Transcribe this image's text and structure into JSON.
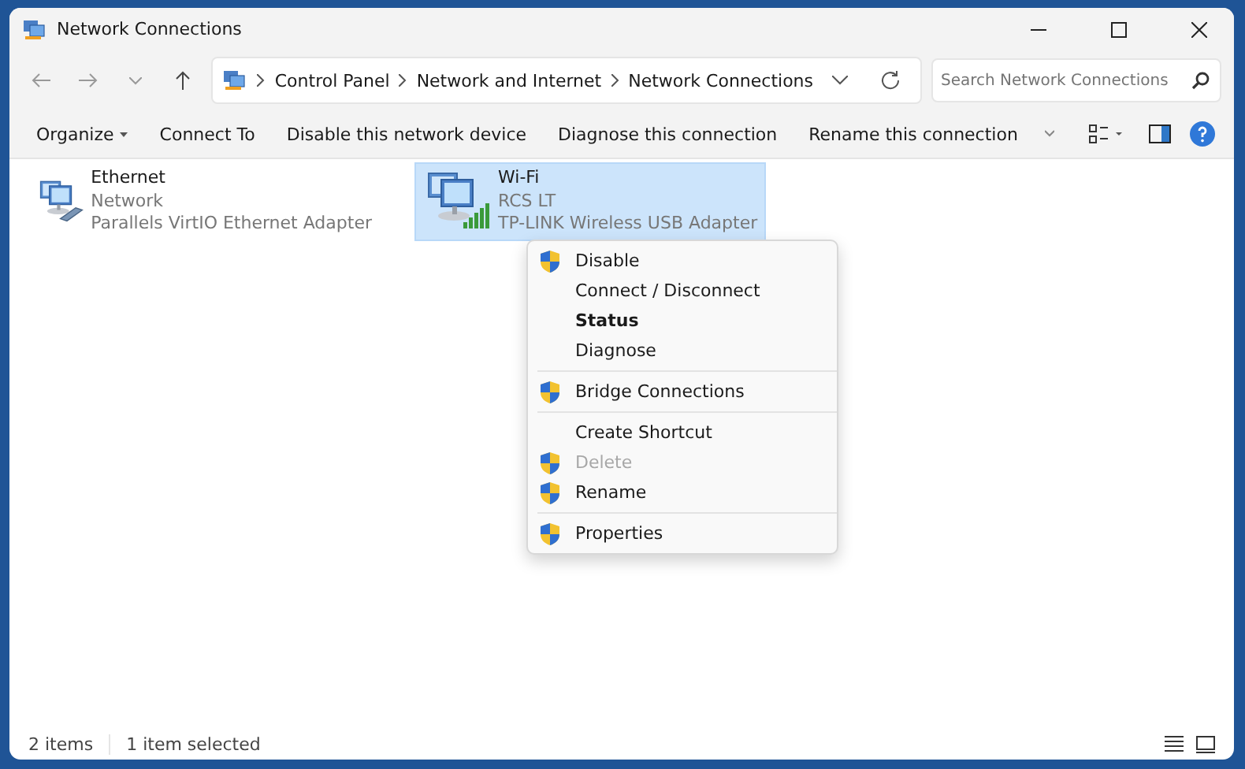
{
  "window": {
    "title": "Network Connections"
  },
  "address_bar": {
    "breadcrumbs": [
      "Control Panel",
      "Network and Internet",
      "Network Connections"
    ]
  },
  "search": {
    "placeholder": "Search Network Connections"
  },
  "toolbar": [
    {
      "label": "Organize",
      "dropdown": true
    },
    {
      "label": "Connect To",
      "dropdown": false
    },
    {
      "label": "Disable this network device",
      "dropdown": false
    },
    {
      "label": "Diagnose this connection",
      "dropdown": false
    },
    {
      "label": "Rename this connection",
      "dropdown": false
    }
  ],
  "connections": [
    {
      "kind": "wired",
      "name": "Ethernet",
      "status": "Network",
      "adapter": "Parallels VirtIO Ethernet Adapter",
      "selected": false
    },
    {
      "kind": "wireless",
      "name": "Wi-Fi",
      "status": "RCS LT",
      "adapter": "TP-LINK Wireless USB Adapter",
      "selected": true
    }
  ],
  "context_menu": [
    {
      "kind": "item",
      "label": "Disable",
      "shield": true,
      "bold": false,
      "disabled": false
    },
    {
      "kind": "item",
      "label": "Connect / Disconnect",
      "shield": false,
      "bold": false,
      "disabled": false
    },
    {
      "kind": "item",
      "label": "Status",
      "shield": false,
      "bold": true,
      "disabled": false
    },
    {
      "kind": "item",
      "label": "Diagnose",
      "shield": false,
      "bold": false,
      "disabled": false
    },
    {
      "kind": "separator"
    },
    {
      "kind": "item",
      "label": "Bridge Connections",
      "shield": true,
      "bold": false,
      "disabled": false
    },
    {
      "kind": "separator"
    },
    {
      "kind": "item",
      "label": "Create Shortcut",
      "shield": false,
      "bold": false,
      "disabled": false
    },
    {
      "kind": "item",
      "label": "Delete",
      "shield": true,
      "bold": false,
      "disabled": true
    },
    {
      "kind": "item",
      "label": "Rename",
      "shield": true,
      "bold": false,
      "disabled": false
    },
    {
      "kind": "separator"
    },
    {
      "kind": "item",
      "label": "Properties",
      "shield": true,
      "bold": false,
      "disabled": false
    }
  ],
  "status_bar": {
    "items": "2 items",
    "selection": "1 item selected"
  }
}
